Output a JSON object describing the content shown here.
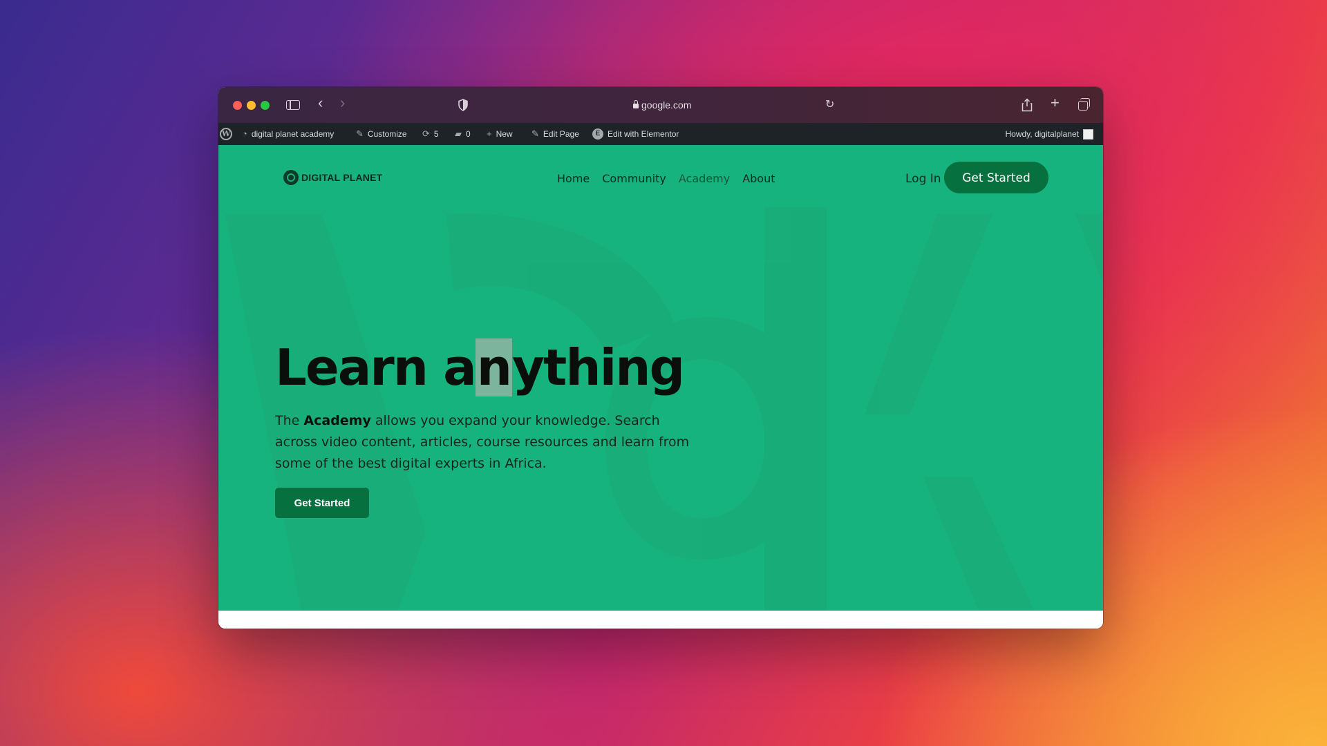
{
  "browser": {
    "url": "google.com",
    "icons": [
      "sidebar-icon",
      "back-icon",
      "forward-icon",
      "shield-icon",
      "lock-icon",
      "reload-icon",
      "share-icon",
      "plus-icon",
      "tabs-icon"
    ]
  },
  "wp_admin_bar": {
    "site_name": "digital planet academy",
    "customize": "Customize",
    "updates_count": "5",
    "comments_count": "0",
    "new": "New",
    "edit_page": "Edit Page",
    "edit_elementor": "Edit with Elementor",
    "greeting": "Howdy, digitalplanet"
  },
  "site": {
    "logo_text": "DIGITAL PLANET",
    "nav": [
      {
        "label": "Home"
      },
      {
        "label": "Community"
      },
      {
        "label": "Academy"
      },
      {
        "label": "About"
      }
    ],
    "login": "Log In",
    "header_cta": "Get Started",
    "hero": {
      "title_part1": "Learn a",
      "title_selected": "n",
      "title_part2": "ything",
      "text_prefix": "The ",
      "text_bold": "Academy",
      "text_rest": " allows you expand your knowledge. Search across video content, articles, course resources and learn from some of the best digital experts in Africa.",
      "cta": "Get Started"
    },
    "colors": {
      "background": "#17b37e",
      "button": "#07703f"
    }
  }
}
